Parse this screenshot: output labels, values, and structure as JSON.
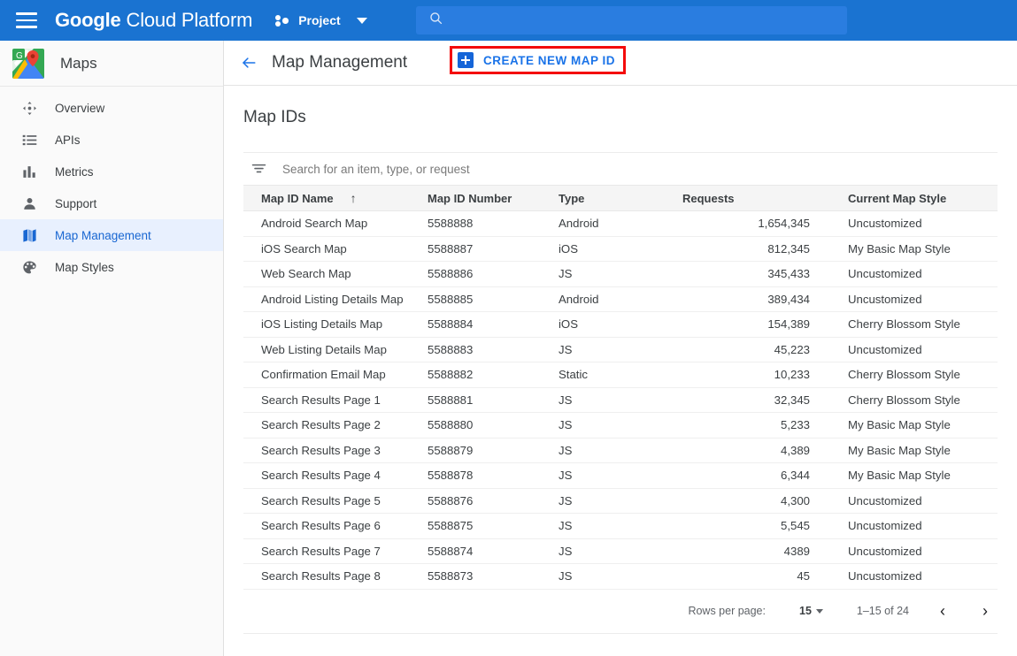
{
  "topbar": {
    "menu_icon": "hamburger-icon",
    "brand_bold": "Google",
    "brand_light": "Cloud Platform",
    "project_label": "Project",
    "project_icon": "project-dots-icon",
    "dropdown_icon": "chevron-down-icon",
    "search_icon": "search-icon",
    "search_value": "",
    "search_placeholder": "",
    "bar_color": "#1a73d1"
  },
  "sidebar": {
    "product_title": "Maps",
    "product_logo": "google-maps-logo",
    "active_highlight": "#e8f0fe",
    "active_text_color": "#1967d2",
    "items": [
      {
        "label": "Overview",
        "icon": "overview-arrows-icon",
        "active": false
      },
      {
        "label": "APIs",
        "icon": "list-icon",
        "active": false
      },
      {
        "label": "Metrics",
        "icon": "bar-chart-icon",
        "active": false
      },
      {
        "label": "Support",
        "icon": "person-icon",
        "active": false
      },
      {
        "label": "Map Management",
        "icon": "map-icon",
        "active": true
      },
      {
        "label": "Map Styles",
        "icon": "palette-icon",
        "active": false
      }
    ]
  },
  "page": {
    "back_icon": "back-arrow-icon",
    "title": "Map Management",
    "create_button_label": "CREATE NEW MAP ID",
    "create_button_icon": "plus-square-icon",
    "highlight_box_color": "#f40b0b",
    "accent_color": "#1a73e8",
    "section_title": "Map IDs"
  },
  "filter": {
    "icon": "filter-funnel-icon",
    "value": "",
    "placeholder": "Search for an item, type, or request"
  },
  "table": {
    "columns": [
      {
        "key": "name",
        "label": "Map ID Name",
        "sorted": true,
        "sort_icon": "sort-ascending-arrow"
      },
      {
        "key": "num",
        "label": "Map ID Number",
        "sorted": false
      },
      {
        "key": "type",
        "label": "Type",
        "sorted": false
      },
      {
        "key": "req",
        "label": "Requests",
        "sorted": false
      },
      {
        "key": "style",
        "label": "Current Map Style",
        "sorted": false
      }
    ],
    "rows": [
      {
        "name": "Android Search Map",
        "num": "5588888",
        "type": "Android",
        "req": "1,654,345",
        "style": "Uncustomized"
      },
      {
        "name": "iOS Search Map",
        "num": "5588887",
        "type": "iOS",
        "req": "812,345",
        "style": "My Basic Map Style"
      },
      {
        "name": "Web Search Map",
        "num": "5588886",
        "type": "JS",
        "req": "345,433",
        "style": "Uncustomized"
      },
      {
        "name": "Android Listing Details Map",
        "num": "5588885",
        "type": "Android",
        "req": "389,434",
        "style": "Uncustomized"
      },
      {
        "name": "iOS Listing Details Map",
        "num": "5588884",
        "type": "iOS",
        "req": "154,389",
        "style": "Cherry Blossom Style"
      },
      {
        "name": "Web Listing Details Map",
        "num": "5588883",
        "type": "JS",
        "req": "45,223",
        "style": "Uncustomized"
      },
      {
        "name": "Confirmation Email Map",
        "num": "5588882",
        "type": "Static",
        "req": "10,233",
        "style": "Cherry Blossom Style"
      },
      {
        "name": "Search Results Page 1",
        "num": "5588881",
        "type": "JS",
        "req": "32,345",
        "style": "Cherry Blossom Style"
      },
      {
        "name": "Search Results Page 2",
        "num": "5588880",
        "type": "JS",
        "req": "5,233",
        "style": "My Basic Map Style"
      },
      {
        "name": "Search Results Page 3",
        "num": "5588879",
        "type": "JS",
        "req": "4,389",
        "style": "My Basic Map Style"
      },
      {
        "name": "Search Results Page 4",
        "num": "5588878",
        "type": "JS",
        "req": "6,344",
        "style": "My Basic Map Style"
      },
      {
        "name": "Search Results Page 5",
        "num": "5588876",
        "type": "JS",
        "req": "4,300",
        "style": "Uncustomized"
      },
      {
        "name": "Search Results Page 6",
        "num": "5588875",
        "type": "JS",
        "req": "5,545",
        "style": "Uncustomized"
      },
      {
        "name": "Search Results Page 7",
        "num": "5588874",
        "type": "JS",
        "req": "4389",
        "style": "Uncustomized"
      },
      {
        "name": "Search Results Page 8",
        "num": "5588873",
        "type": "JS",
        "req": "45",
        "style": "Uncustomized"
      }
    ]
  },
  "pagination": {
    "rows_per_page_label": "Rows per page:",
    "rows_per_page_value": "15",
    "range_label": "1–15 of 24",
    "prev_icon": "chevron-left-icon",
    "next_icon": "chevron-right-icon",
    "prev_glyph": "‹",
    "next_glyph": "›"
  }
}
